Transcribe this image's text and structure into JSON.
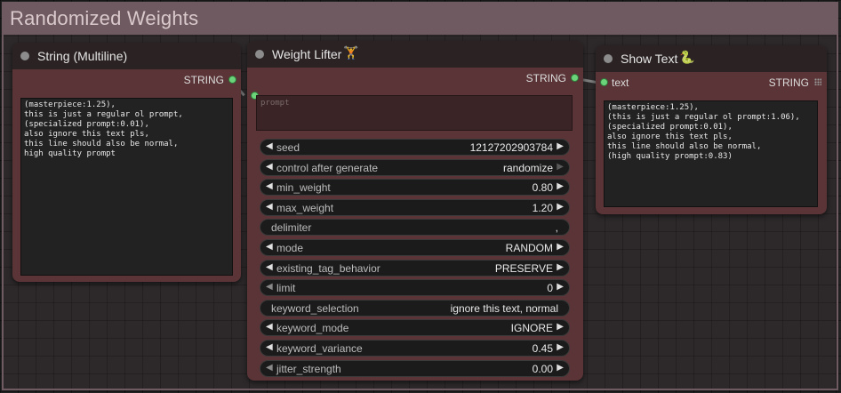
{
  "group": {
    "title": "Randomized Weights"
  },
  "string_node": {
    "title": "String (Multiline)",
    "output_label": "STRING",
    "text": "(masterpiece:1.25),\nthis is just a regular ol prompt,\n(specialized prompt:0.01),\nalso ignore this text pls,\nthis line should also be normal,\nhigh quality prompt"
  },
  "weight_node": {
    "title": "Weight Lifter",
    "title_icon": "🏋",
    "output_label": "STRING",
    "prompt_placeholder": "prompt",
    "widgets": [
      {
        "label": "seed",
        "value": "12127202903784",
        "type": "combo"
      },
      {
        "label": "control after generate",
        "value": "randomize",
        "type": "combo",
        "right_dim": true
      },
      {
        "label": "min_weight",
        "value": "0.80",
        "type": "combo"
      },
      {
        "label": "max_weight",
        "value": "1.20",
        "type": "combo"
      },
      {
        "label": "delimiter",
        "value": ",",
        "type": "text"
      },
      {
        "label": "mode",
        "value": "RANDOM",
        "type": "combo"
      },
      {
        "label": "existing_tag_behavior",
        "value": "PRESERVE",
        "type": "combo"
      },
      {
        "label": "limit",
        "value": "0",
        "type": "combo",
        "left_dim": true
      },
      {
        "label": "keyword_selection",
        "value": "ignore this text, normal",
        "type": "text"
      },
      {
        "label": "keyword_mode",
        "value": "IGNORE",
        "type": "combo"
      },
      {
        "label": "keyword_variance",
        "value": "0.45",
        "type": "combo"
      },
      {
        "label": "jitter_strength",
        "value": "0.00",
        "type": "combo",
        "left_dim": true
      }
    ]
  },
  "show_node": {
    "title": "Show Text",
    "title_icon": "🐍",
    "input_label": "text",
    "output_label": "STRING",
    "text": "(masterpiece:1.25),\n(this is just a regular ol prompt:1.06),\n(specialized prompt:0.01),\nalso ignore this text pls,\nthis line should also be normal,\n(high quality prompt:0.83)"
  },
  "colors": {
    "node_body": "#5a3436",
    "node_title": "#2a2223",
    "slot_connected": "#6bd47a",
    "group": "#6e5a60"
  }
}
